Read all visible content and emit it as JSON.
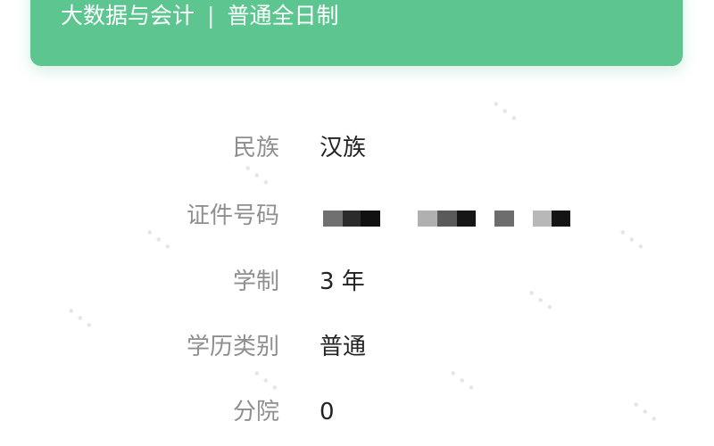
{
  "header": {
    "major": "大数据与会计",
    "separator": "|",
    "study_mode": "普通全日制"
  },
  "fields": [
    {
      "label": "民族",
      "value": "汉族"
    },
    {
      "label": "证件号码",
      "value": ""
    },
    {
      "label": "学制",
      "value": "3 年"
    },
    {
      "label": "学历类别",
      "value": "普通"
    },
    {
      "label": "分院",
      "value": "0"
    }
  ],
  "colors": {
    "banner": "#5dc690",
    "label": "#8f8f8f",
    "value": "#222222"
  }
}
